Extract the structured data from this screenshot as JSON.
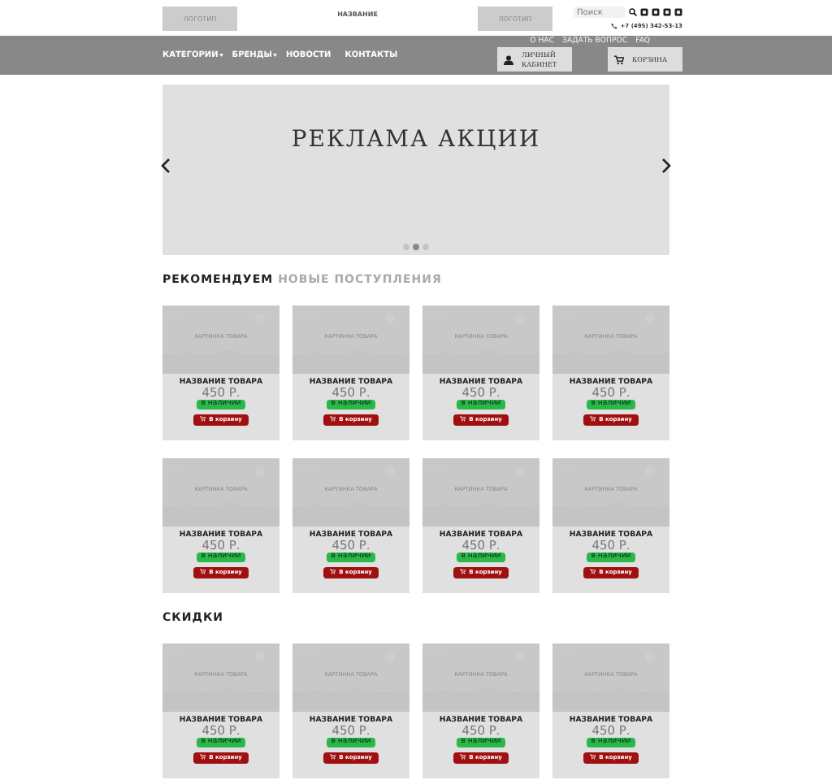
{
  "header": {
    "logos": [
      "ЛОГОТИП",
      "ЛОГОТИП"
    ],
    "title": "НАЗВАНИЕ",
    "search": {
      "placeholder": "Поиск"
    },
    "phone": "+7 (495) 342-53-13"
  },
  "nav": {
    "items": [
      {
        "label": "КАТЕГОРИИ",
        "dropdown": true
      },
      {
        "label": "БРЕНДЫ",
        "dropdown": true
      },
      {
        "label": "НОВОСТИ",
        "dropdown": false
      },
      {
        "label": "КОНТАКТЫ",
        "dropdown": false
      }
    ],
    "top_links": [
      "О НАС",
      "ЗАДАТЬ ВОПРОС",
      "FAQ"
    ],
    "account_button": "ЛИЧНЫЙ КАБИНЕТ",
    "cart_button": "КОРЗИНА"
  },
  "banner": {
    "title": "РЕКЛАМА АКЦИИ",
    "dots": [
      {
        "selected": false
      },
      {
        "selected": true
      },
      {
        "selected": false
      }
    ]
  },
  "sections": [
    {
      "tabs": [
        {
          "label": "РЕКОМЕНДУЕМ",
          "selected": true
        },
        {
          "label": "НОВЫЕ ПОСТУПЛЕНИЯ",
          "selected": false
        }
      ],
      "products": [
        {
          "image": "КАРТИНКА ТОВАРА",
          "name": "НАЗВАНИЕ ТОВАРА",
          "price": "450 Р.",
          "stock": "в наличии",
          "button": "В корзину"
        },
        {
          "image": "КАРТИНКА ТОВАРА",
          "name": "НАЗВАНИЕ ТОВАРА",
          "price": "450 Р.",
          "stock": "в наличии",
          "button": "В корзину"
        },
        {
          "image": "КАРТИНКА ТОВАРА",
          "name": "НАЗВАНИЕ ТОВАРА",
          "price": "450 Р.",
          "stock": "в наличии",
          "button": "В корзину"
        },
        {
          "image": "КАРТИНКА ТОВАРА",
          "name": "НАЗВАНИЕ ТОВАРА",
          "price": "450 Р.",
          "stock": "в наличии",
          "button": "В корзину"
        },
        {
          "image": "КАРТИНКА ТОВАРА",
          "name": "НАЗВАНИЕ ТОВАРА",
          "price": "450 Р.",
          "stock": "в наличии",
          "button": "В корзину"
        },
        {
          "image": "КАРТИНКА ТОВАРА",
          "name": "НАЗВАНИЕ ТОВАРА",
          "price": "450 Р.",
          "stock": "в наличии",
          "button": "В корзину"
        },
        {
          "image": "КАРТИНКА ТОВАРА",
          "name": "НАЗВАНИЕ ТОВАРА",
          "price": "450 Р.",
          "stock": "в наличии",
          "button": "В корзину"
        },
        {
          "image": "КАРТИНКА ТОВАРА",
          "name": "НАЗВАНИЕ ТОВАРА",
          "price": "450 Р.",
          "stock": "в наличии",
          "button": "В корзину"
        }
      ]
    },
    {
      "tabs": [
        {
          "label": "СКИДКИ",
          "selected": true
        }
      ],
      "products": [
        {
          "image": "КАРТИНКА ТОВАРА",
          "name": "НАЗВАНИЕ ТОВАРА",
          "price": "450 Р.",
          "stock": "в наличии",
          "button": "В корзину"
        },
        {
          "image": "КАРТИНКА ТОВАРА",
          "name": "НАЗВАНИЕ ТОВАРА",
          "price": "450 Р.",
          "stock": "в наличии",
          "button": "В корзину"
        },
        {
          "image": "КАРТИНКА ТОВАРА",
          "name": "НАЗВАНИЕ ТОВАРА",
          "price": "450 Р.",
          "stock": "в наличии",
          "button": "В корзину"
        },
        {
          "image": "КАРТИНКА ТОВАРА",
          "name": "НАЗВАНИЕ ТОВАРА",
          "price": "450 Р.",
          "stock": "в наличии",
          "button": "В корзину"
        }
      ]
    }
  ]
}
